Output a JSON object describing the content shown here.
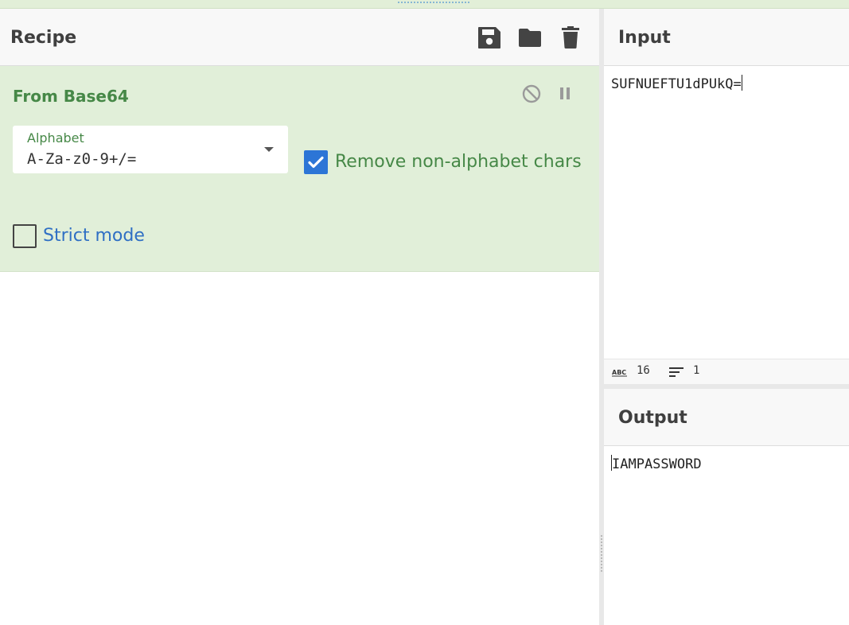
{
  "recipe": {
    "title": "Recipe",
    "save_icon": "save-icon",
    "load_icon": "folder-icon",
    "clear_icon": "trash-icon"
  },
  "operation": {
    "title": "From Base64",
    "disable_icon": "disable-icon",
    "breakpoint_icon": "pause-icon",
    "alphabet": {
      "label": "Alphabet",
      "value": "A-Za-z0-9+/="
    },
    "remove_non_alpha": {
      "label": "Remove non-alphabet chars",
      "checked": true
    },
    "strict_mode": {
      "label": "Strict mode",
      "checked": false
    }
  },
  "input": {
    "title": "Input",
    "value": "SUFNUEFTU1dPUkQ=",
    "stats": {
      "length_icon": "abc-icon",
      "length": "16",
      "lines_icon": "lines-icon",
      "lines": "1"
    }
  },
  "output": {
    "title": "Output",
    "value": "IAMPASSWORD"
  },
  "colors": {
    "operation_bg": "#e1efd9",
    "operation_text": "#468847",
    "checkbox_checked": "#2c75d6",
    "link_blue": "#2f6fc4"
  }
}
